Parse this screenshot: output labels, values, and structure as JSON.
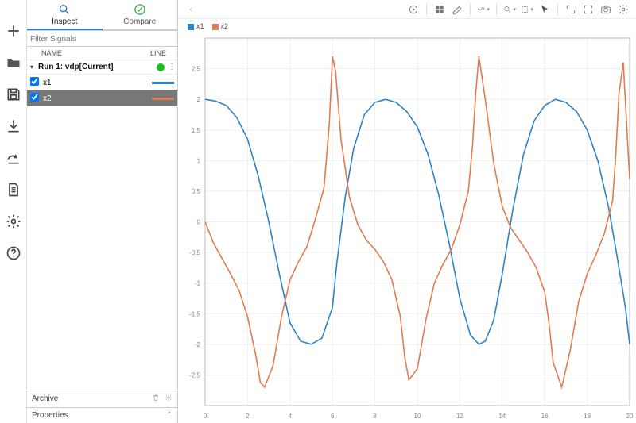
{
  "rail": [
    {
      "name": "add-icon"
    },
    {
      "name": "folder-icon"
    },
    {
      "name": "save-icon"
    },
    {
      "name": "import-icon"
    },
    {
      "name": "export-icon"
    },
    {
      "name": "document-icon"
    },
    {
      "name": "settings-icon"
    },
    {
      "name": "help-icon"
    }
  ],
  "tabs": {
    "inspect": "Inspect",
    "compare": "Compare"
  },
  "filter_placeholder": "Filter Signals",
  "table_header": {
    "name": "NAME",
    "line": "LINE"
  },
  "run_label": "Run 1: vdp[Current]",
  "signals": [
    {
      "name": "x1",
      "color": "#2f83c4",
      "checked": true,
      "selected": false
    },
    {
      "name": "x2",
      "color": "#e07b53",
      "checked": true,
      "selected": true
    }
  ],
  "archive_label": "Archive",
  "properties_label": "Properties",
  "legend": [
    {
      "label": "x1",
      "color": "#2f83c4"
    },
    {
      "label": "x2",
      "color": "#e07b53"
    }
  ],
  "chart_data": {
    "type": "line",
    "xlabel": "",
    "ylabel": "",
    "xlim": [
      0,
      20
    ],
    "ylim": [
      -3,
      3
    ],
    "xticks": [
      0,
      2,
      4,
      6,
      8,
      10,
      12,
      14,
      16,
      18,
      20
    ],
    "yticks": [
      -2.5,
      -2.0,
      -1.5,
      -1.0,
      -0.5,
      0,
      0.5,
      1.0,
      1.5,
      2.0,
      2.5
    ],
    "grid": true,
    "series": [
      {
        "name": "x1",
        "color": "#2f83c4",
        "x": [
          0,
          0.5,
          1,
          1.5,
          2,
          2.5,
          3,
          3.5,
          4,
          4.5,
          5,
          5.5,
          6,
          6.2,
          6.6,
          7,
          7.5,
          8,
          8.5,
          9,
          9.5,
          10,
          10.5,
          11,
          11.5,
          12,
          12.5,
          12.9,
          13.2,
          13.6,
          14,
          14.5,
          15,
          15.5,
          16,
          16.5,
          17,
          17.5,
          18,
          18.5,
          19,
          19.4,
          19.8,
          20
        ],
        "y": [
          2.0,
          1.97,
          1.9,
          1.7,
          1.35,
          0.75,
          0.0,
          -0.85,
          -1.65,
          -1.95,
          -2.0,
          -1.9,
          -1.4,
          -0.7,
          0.4,
          1.2,
          1.75,
          1.95,
          2.0,
          1.95,
          1.8,
          1.55,
          1.1,
          0.45,
          -0.35,
          -1.25,
          -1.85,
          -2.0,
          -1.95,
          -1.6,
          -0.85,
          0.2,
          1.1,
          1.65,
          1.9,
          2.0,
          1.95,
          1.8,
          1.5,
          1.0,
          0.25,
          -0.55,
          -1.4,
          -2.0
        ]
      },
      {
        "name": "x2",
        "color": "#e07b53",
        "x": [
          0,
          0.4,
          0.8,
          1.2,
          1.6,
          2,
          2.4,
          2.6,
          2.8,
          3.2,
          3.6,
          4,
          4.4,
          4.8,
          5.2,
          5.6,
          5.85,
          6.0,
          6.15,
          6.4,
          6.8,
          7.2,
          7.6,
          8,
          8.4,
          8.8,
          9.2,
          9.4,
          9.6,
          10,
          10.4,
          10.8,
          11.2,
          11.6,
          12,
          12.4,
          12.6,
          12.75,
          12.9,
          13.2,
          13.6,
          14,
          14.4,
          14.8,
          15.2,
          15.6,
          16,
          16.2,
          16.4,
          16.8,
          17.2,
          17.6,
          18,
          18.4,
          18.8,
          19.2,
          19.35,
          19.5,
          19.7,
          20
        ],
        "y": [
          0.0,
          -0.35,
          -0.6,
          -0.85,
          -1.12,
          -1.55,
          -2.2,
          -2.62,
          -2.7,
          -2.35,
          -1.55,
          -0.95,
          -0.65,
          -0.4,
          0.05,
          0.55,
          1.6,
          2.7,
          2.45,
          1.35,
          0.4,
          -0.05,
          -0.3,
          -0.45,
          -0.65,
          -0.95,
          -1.55,
          -2.2,
          -2.58,
          -2.4,
          -1.6,
          -1.0,
          -0.7,
          -0.45,
          -0.05,
          0.5,
          1.25,
          2.1,
          2.7,
          2.0,
          0.95,
          0.25,
          -0.1,
          -0.3,
          -0.5,
          -0.75,
          -1.15,
          -1.65,
          -2.3,
          -2.7,
          -2.1,
          -1.3,
          -0.85,
          -0.55,
          -0.2,
          0.35,
          1.1,
          2.1,
          2.6,
          0.7
        ]
      }
    ]
  }
}
